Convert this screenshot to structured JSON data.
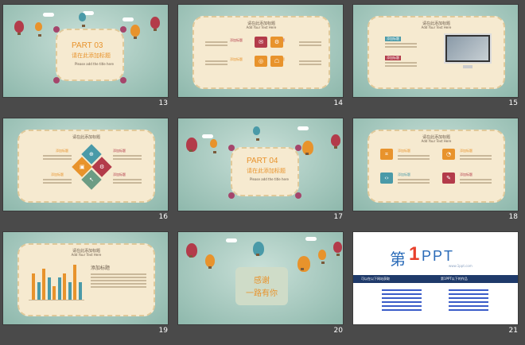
{
  "slides": [
    {
      "number": "13",
      "part": "PART 03",
      "heading": "请在此添加标题",
      "sub": "Please add the title here"
    },
    {
      "number": "14",
      "title": "请在此添加标题",
      "subtitle": "Add Your Text Here",
      "labels": [
        "添加标题",
        "添加标题",
        "添加标题",
        "添加标题"
      ]
    },
    {
      "number": "15",
      "title": "请在此添加标题",
      "subtitle": "Add Your Text Here",
      "labels": [
        "添加标题",
        "添加标题"
      ]
    },
    {
      "number": "16",
      "title": "请在此添加标题",
      "labels": [
        "添加标题",
        "添加标题",
        "添加标题",
        "添加标题"
      ]
    },
    {
      "number": "17",
      "part": "PART 04",
      "heading": "请在此添加标题",
      "sub": "Please add the title here"
    },
    {
      "number": "18",
      "title": "请在此添加标题",
      "subtitle": "Add Your Text Here",
      "labels": [
        "添加标题",
        "添加标题",
        "添加标题",
        "添加标题"
      ]
    },
    {
      "number": "19",
      "title": "请在此添加标题",
      "subtitle": "Add Your Text Here",
      "heading": "添加标题",
      "bars": [
        6,
        4,
        7,
        5,
        3,
        5,
        6,
        4,
        8,
        4
      ]
    },
    {
      "number": "20",
      "line1": "感谢",
      "line2": "一路有你"
    },
    {
      "number": "21",
      "logo_prefix": "第",
      "logo_mid": "1",
      "logo_suffix": "PPT",
      "logo_url": "www.1ppt.com",
      "col1": "可以在以下网站获取",
      "col2": "第1PPT以下的作品"
    }
  ],
  "colors": {
    "bg": "#4a4a4a",
    "accent_orange": "#e8932c",
    "accent_teal": "#4a9aa8",
    "accent_red": "#b33b4a",
    "accent_green": "#6c9c84",
    "frame": "#f6ead0"
  }
}
